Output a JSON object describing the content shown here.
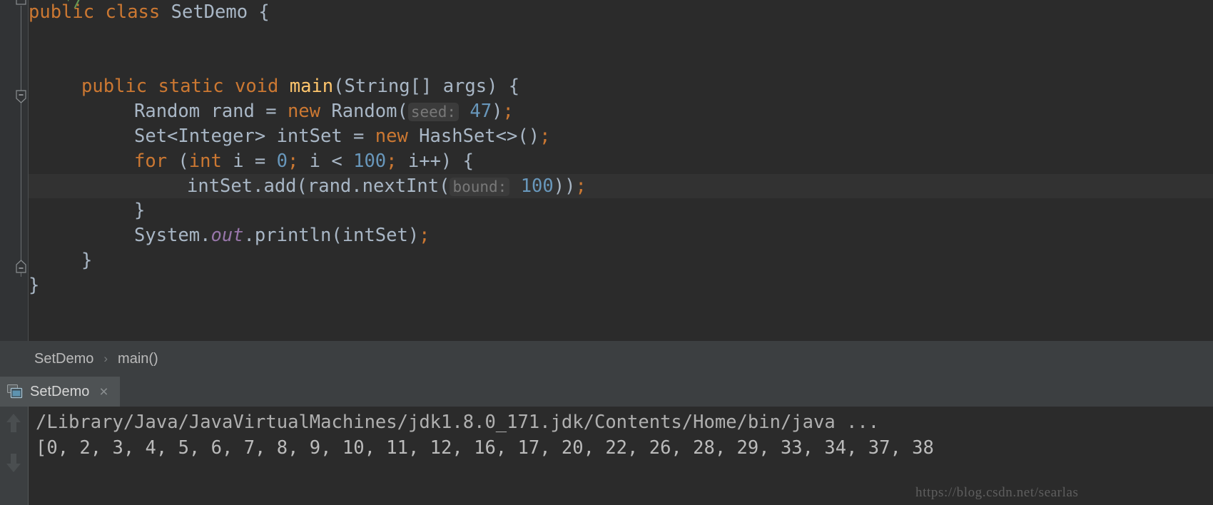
{
  "app": {
    "theme": "darcula",
    "colors": {
      "editor_bg": "#2b2b2b",
      "gutter_bg": "#313335",
      "panel_bg": "#3c3f41",
      "active_tab_bg": "#4e5254",
      "caret_row_bg": "#323232",
      "keyword": "#cc7832",
      "number": "#6897bb",
      "identifier": "#a9b7c6",
      "method_name": "#ffc66d",
      "static_field": "#9876aa",
      "comment": "#629755",
      "param_hint": "#787878",
      "param_hint_bg": "#3b3b3b",
      "console_text": "#bbbbbb"
    }
  },
  "editor": {
    "top_comment_fragment": "*/",
    "lines": [
      {
        "id": "class-decl",
        "indent": 0,
        "highlight": false,
        "tokens": [
          {
            "text": "public",
            "type": "kw"
          },
          {
            "text": " ",
            "type": "punct"
          },
          {
            "text": "class",
            "type": "kw"
          },
          {
            "text": " ",
            "type": "punct"
          },
          {
            "text": "SetDemo",
            "type": "ident"
          },
          {
            "text": " {",
            "type": "punct"
          }
        ]
      },
      {
        "id": "blank-1",
        "indent": 0,
        "highlight": false,
        "tokens": []
      },
      {
        "id": "blank-2",
        "indent": 0,
        "highlight": false,
        "tokens": []
      },
      {
        "id": "main-decl",
        "indent": 1,
        "highlight": false,
        "tokens": [
          {
            "text": "public",
            "type": "kw"
          },
          {
            "text": " ",
            "type": "punct"
          },
          {
            "text": "static",
            "type": "kw"
          },
          {
            "text": " ",
            "type": "punct"
          },
          {
            "text": "void",
            "type": "kw"
          },
          {
            "text": " ",
            "type": "punct"
          },
          {
            "text": "main",
            "type": "mname"
          },
          {
            "text": "(String[] args) {",
            "type": "punct"
          }
        ]
      },
      {
        "id": "random-decl",
        "indent": 2,
        "highlight": false,
        "tokens": [
          {
            "text": "Random rand = ",
            "type": "ident"
          },
          {
            "text": "new",
            "type": "kw"
          },
          {
            "text": " Random(",
            "type": "ident"
          },
          {
            "text": "seed:",
            "type": "hint"
          },
          {
            "text": " ",
            "type": "punct"
          },
          {
            "text": "47",
            "type": "num"
          },
          {
            "text": ")",
            "type": "punct"
          },
          {
            "text": ";",
            "type": "semi"
          }
        ]
      },
      {
        "id": "set-decl",
        "indent": 2,
        "highlight": false,
        "tokens": [
          {
            "text": "Set<Integer> intSet = ",
            "type": "ident"
          },
          {
            "text": "new",
            "type": "kw"
          },
          {
            "text": " HashSet<>()",
            "type": "ident"
          },
          {
            "text": ";",
            "type": "semi"
          }
        ]
      },
      {
        "id": "for-loop",
        "indent": 2,
        "highlight": false,
        "tokens": [
          {
            "text": "for",
            "type": "kw"
          },
          {
            "text": " (",
            "type": "punct"
          },
          {
            "text": "int",
            "type": "kw"
          },
          {
            "text": " i = ",
            "type": "ident"
          },
          {
            "text": "0",
            "type": "num"
          },
          {
            "text": ";",
            "type": "semi"
          },
          {
            "text": " i < ",
            "type": "ident"
          },
          {
            "text": "100",
            "type": "num"
          },
          {
            "text": ";",
            "type": "semi"
          },
          {
            "text": " i++) {",
            "type": "ident"
          }
        ]
      },
      {
        "id": "set-add",
        "indent": 3,
        "highlight": true,
        "tokens": [
          {
            "text": "intSet.add(rand.nextInt(",
            "type": "ident"
          },
          {
            "text": "bound:",
            "type": "hint"
          },
          {
            "text": " ",
            "type": "punct"
          },
          {
            "text": "100",
            "type": "num"
          },
          {
            "text": "))",
            "type": "punct"
          },
          {
            "text": ";",
            "type": "semi"
          }
        ]
      },
      {
        "id": "for-close",
        "indent": 2,
        "highlight": false,
        "tokens": [
          {
            "text": "}",
            "type": "punct"
          }
        ]
      },
      {
        "id": "println",
        "indent": 2,
        "highlight": false,
        "tokens": [
          {
            "text": "System.",
            "type": "ident"
          },
          {
            "text": "out",
            "type": "field"
          },
          {
            "text": ".println(intSet)",
            "type": "ident"
          },
          {
            "text": ";",
            "type": "semi"
          }
        ]
      },
      {
        "id": "main-close",
        "indent": 1,
        "highlight": false,
        "tokens": [
          {
            "text": "}",
            "type": "punct"
          }
        ]
      },
      {
        "id": "class-close",
        "indent": 0,
        "highlight": false,
        "tokens": [
          {
            "text": "}",
            "type": "punct"
          }
        ]
      }
    ]
  },
  "breadcrumb": {
    "class": "SetDemo",
    "separator": "›",
    "method": "main()"
  },
  "run_tab": {
    "icon": "run-console-icon",
    "label": "SetDemo",
    "close": "×"
  },
  "console": {
    "gutter_icons": [
      "scroll-up-icon",
      "scroll-down-icon"
    ],
    "lines": [
      "/Library/Java/JavaVirtualMachines/jdk1.8.0_171.jdk/Contents/Home/bin/java ...",
      "[0, 2, 3, 4, 5, 6, 7, 8, 9, 10, 11, 12, 16, 17, 20, 22, 26, 28, 29, 33, 34, 37, 38"
    ]
  },
  "watermark": {
    "text": "https://blog.csdn.net/searlas"
  }
}
